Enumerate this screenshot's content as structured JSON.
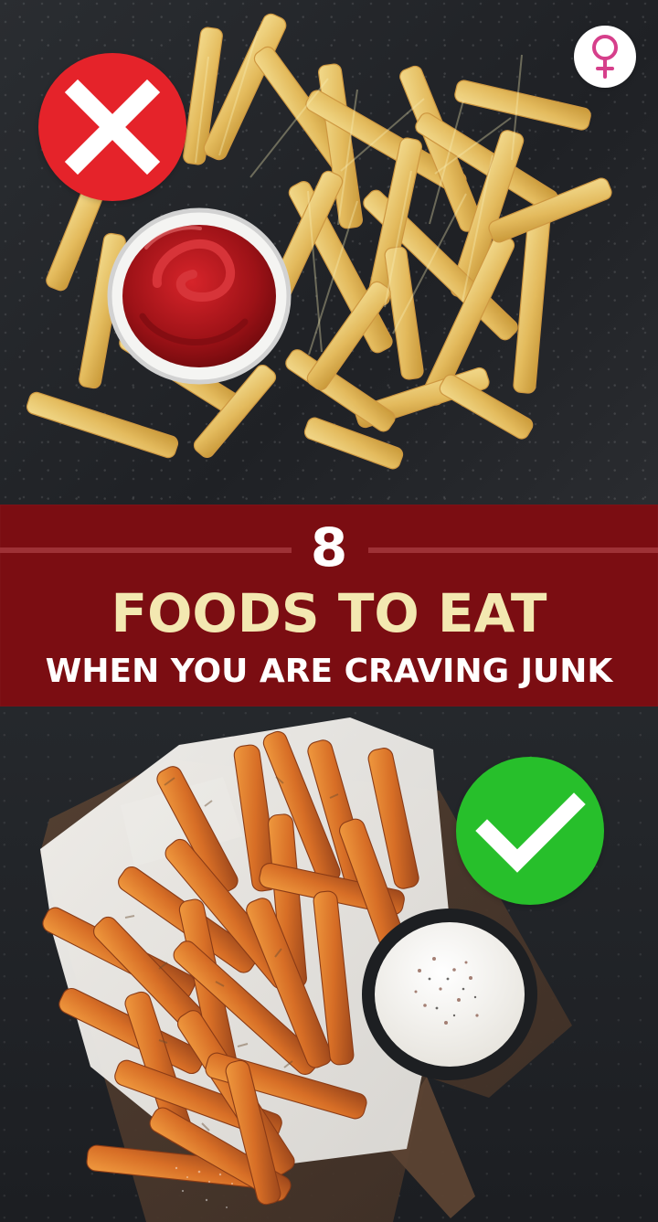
{
  "title": {
    "number": "8",
    "line1": "FOODS TO EAT",
    "line2": "WHEN YOU ARE CRAVING JUNK"
  },
  "badges": {
    "bad_icon": "x-icon",
    "good_icon": "check-icon"
  },
  "logo": {
    "icon": "female-symbol-icon"
  },
  "colors": {
    "banner_bg": "#7b0d12",
    "banner_rule": "#9e3136",
    "title_gold": "#f3e8b1",
    "bad_red": "#e5232a",
    "good_green": "#27bf2b"
  }
}
